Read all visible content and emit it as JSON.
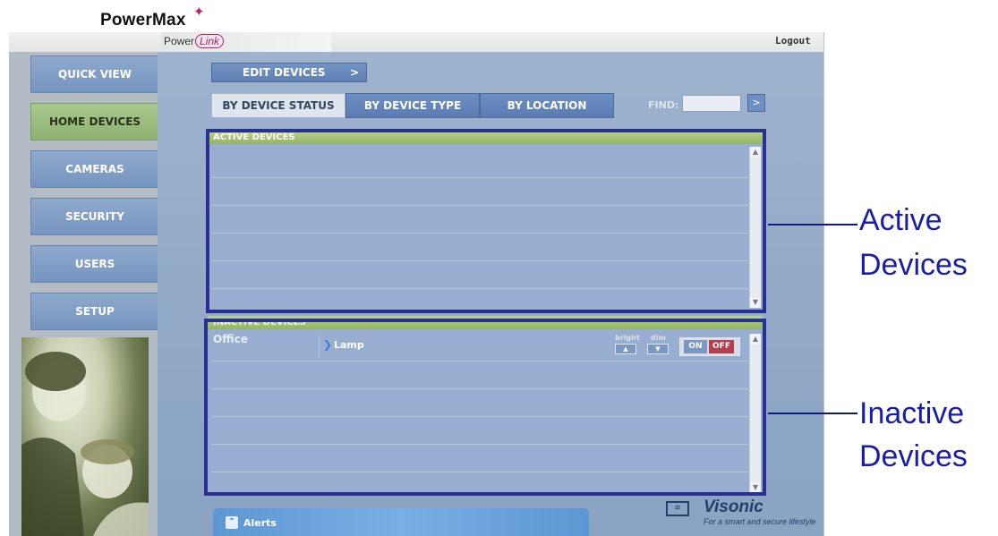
{
  "header": {
    "brand": "PowerMax",
    "sub_brand_prefix": "Power",
    "sub_brand_link": "Link",
    "logout": "Logout"
  },
  "sidebar": {
    "items": [
      {
        "label": "QUICK VIEW",
        "active": false
      },
      {
        "label": "HOME DEVICES",
        "active": true
      },
      {
        "label": "CAMERAS",
        "active": false
      },
      {
        "label": "SECURITY",
        "active": false
      },
      {
        "label": "USERS",
        "active": false
      },
      {
        "label": "SETUP",
        "active": false
      }
    ]
  },
  "main": {
    "edit_devices": "EDIT DEVICES",
    "edit_devices_arrow": ">",
    "tabs": [
      {
        "label": "BY DEVICE STATUS",
        "selected": true
      },
      {
        "label": "BY DEVICE TYPE",
        "selected": false
      },
      {
        "label": "BY LOCATION",
        "selected": false
      }
    ],
    "find_label": "FIND:",
    "find_value": "",
    "find_go": ">",
    "active_panel": {
      "title": "ACTIVE DEVICES"
    },
    "inactive_panel": {
      "title": "INACTIVE DEVICES",
      "rows": [
        {
          "room": "Office",
          "device": "Lamp",
          "bright_label": "bright",
          "dim_label": "dim",
          "on": "ON",
          "off": "OFF"
        }
      ]
    },
    "alerts": "Alerts"
  },
  "footer": {
    "brand": "Visonic",
    "tagline": "For a smart and secure lifestyle"
  },
  "annotations": {
    "active": [
      "Active",
      "Devices"
    ],
    "inactive": [
      "Inactive",
      "Devices"
    ]
  },
  "colors": {
    "outline": "#2a2f92",
    "accent_green": "#93b563",
    "nav_blue": "#7595c0",
    "off_red": "#b43d4e"
  }
}
